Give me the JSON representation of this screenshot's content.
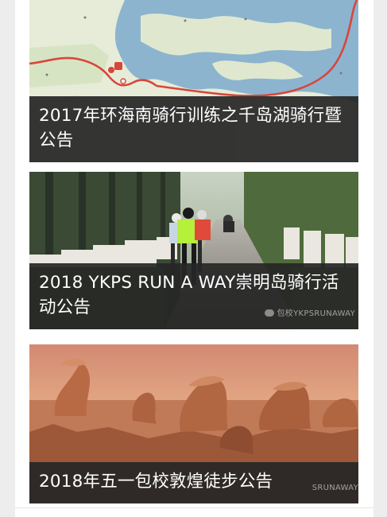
{
  "feed": {
    "cards": [
      {
        "title": "2017年环海南骑行训练之千岛湖骑行暨公告",
        "image_kind": "route-map-image"
      },
      {
        "title": "2018 YKPS RUN A WAY崇明岛骑行活动公告",
        "image_kind": "cycling-photo",
        "watermark": "包校YKPSRUNAWAY"
      },
      {
        "title": "2018年五一包校敦煌徒步公告",
        "image_kind": "desert-rock-photo",
        "watermark": "SRUNAWAY"
      }
    ]
  },
  "colors": {
    "caption_bg": "#262626",
    "map_water": "#8cb4cf",
    "map_land": "#e6ecd8",
    "route": "#d8463b"
  }
}
